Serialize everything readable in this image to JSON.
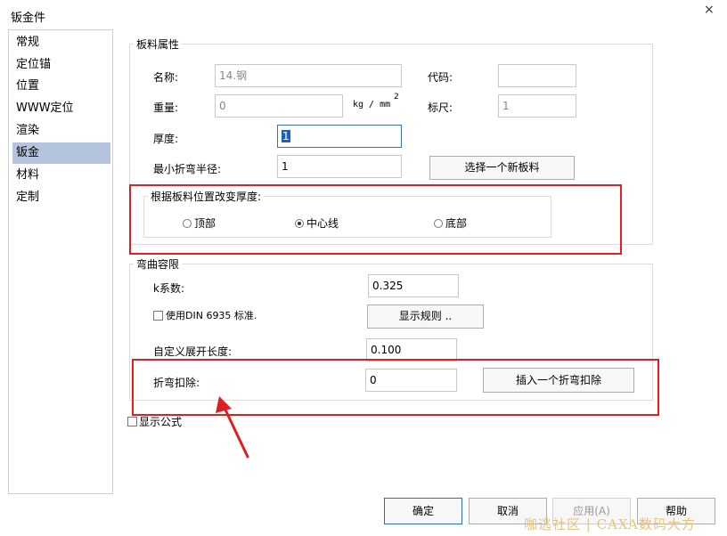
{
  "window": {
    "title": "钣金件",
    "close_glyph": "×"
  },
  "sidebar": {
    "items": [
      {
        "label": "常规"
      },
      {
        "label": "定位锚"
      },
      {
        "label": "位置"
      },
      {
        "label": "WWW定位"
      },
      {
        "label": "渲染"
      },
      {
        "label": "钣金"
      },
      {
        "label": "材料"
      },
      {
        "label": "定制"
      }
    ],
    "selected": "钣金"
  },
  "sheet_props": {
    "title": "板料属性",
    "name_label": "名称:",
    "name_value": "14.钢",
    "code_label": "代码:",
    "code_value": "",
    "weight_label": "重量:",
    "weight_value": "0",
    "weight_unit": "kg / mm",
    "weight_unit_exp": "2",
    "scale_label": "标尺:",
    "scale_value": "1",
    "thickness_label": "厚度:",
    "thickness_value": "1",
    "min_radius_label": "最小折弯半径:",
    "min_radius_value": "1",
    "select_material_button": "选择一个新板料"
  },
  "thickness_position": {
    "title": "根据板料位置改变厚度:",
    "options": [
      "顶部",
      "中心线",
      "底部"
    ],
    "selected": "中心线"
  },
  "bend_allowance": {
    "title": "弯曲容限",
    "k_label": "k系数:",
    "k_value": "0.325",
    "din_label": "使用DIN 6935 标准.",
    "din_checked": false,
    "show_rules_button": "显示规则 ..",
    "custom_length_label": "自定义展开长度:",
    "custom_length_value": "0.100",
    "deduction_label": "折弯扣除:",
    "deduction_value": "0",
    "insert_deduction_button": "插入一个折弯扣除"
  },
  "show_formula": {
    "label": "显示公式",
    "checked": false
  },
  "footer": {
    "ok": "确定",
    "cancel": "取消",
    "apply": "应用(A)",
    "help": "帮助"
  },
  "watermark": "咖逃社区 | CAXA数码大方",
  "annotation": {
    "highlight_color": "#e02020"
  }
}
